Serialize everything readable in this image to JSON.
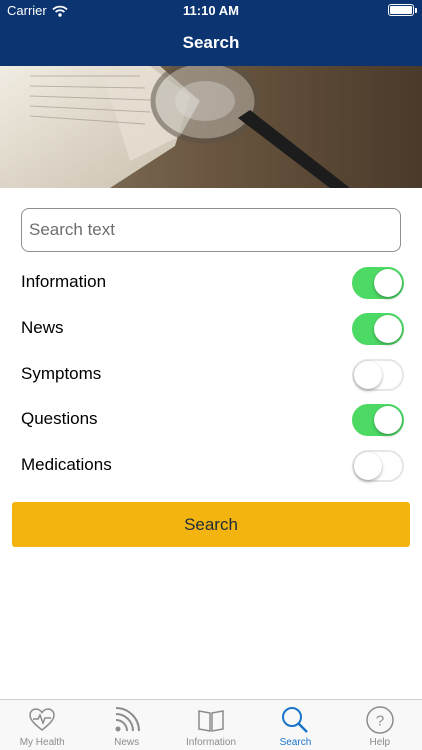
{
  "status_bar": {
    "carrier": "Carrier",
    "time": "11:10 AM"
  },
  "nav": {
    "title": "Search"
  },
  "search": {
    "placeholder": "Search text",
    "value": ""
  },
  "filters": [
    {
      "label": "Information",
      "on": true
    },
    {
      "label": "News",
      "on": true
    },
    {
      "label": "Symptoms",
      "on": false
    },
    {
      "label": "Questions",
      "on": true
    },
    {
      "label": "Medications",
      "on": false
    }
  ],
  "button": {
    "label": "Search"
  },
  "tabs": [
    {
      "label": "My Health",
      "icon": "heart-pulse-icon",
      "active": false
    },
    {
      "label": "News",
      "icon": "rss-icon",
      "active": false
    },
    {
      "label": "Information",
      "icon": "book-icon",
      "active": false
    },
    {
      "label": "Search",
      "icon": "magnifier-icon",
      "active": true
    },
    {
      "label": "Help",
      "icon": "question-icon",
      "active": false
    }
  ],
  "colors": {
    "nav_bar": "#0b3470",
    "toggle_on": "#4cd964",
    "button": "#f3b40f",
    "tab_active": "#1b73c9",
    "tab_inactive": "#8c8c8c"
  }
}
